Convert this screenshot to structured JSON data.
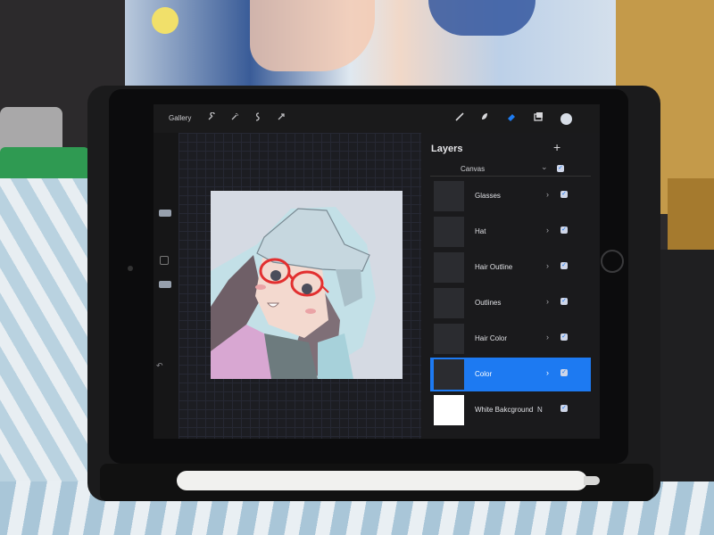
{
  "app": {
    "gallery_label": "Gallery"
  },
  "toolbar": {
    "left_tools": [
      "wrench-icon",
      "magic-wand-icon",
      "selection-icon",
      "transform-arrow-icon"
    ],
    "right_tools": [
      "brush-icon",
      "smudge-icon",
      "eraser-icon",
      "layers-icon",
      "color-icon"
    ],
    "active_color": "#d7dde6",
    "accent_color": "#1e7cf2"
  },
  "layers": {
    "title": "Layers",
    "add_icon": "+",
    "canvas_label": "Canvas",
    "items": [
      {
        "name": "Glasses",
        "visible": true,
        "active": false
      },
      {
        "name": "Hat",
        "visible": true,
        "active": false
      },
      {
        "name": "Hair Outline",
        "visible": true,
        "active": false
      },
      {
        "name": "Outlines",
        "visible": true,
        "active": false
      },
      {
        "name": "Hair Color",
        "visible": true,
        "active": false
      },
      {
        "name": "Color",
        "visible": true,
        "active": true
      },
      {
        "name": "White Bakcground",
        "visible": true,
        "active": false,
        "blend_mode": "N"
      }
    ]
  },
  "glyphs": {
    "chevron": "›",
    "check": "✓",
    "chevron_down": "⌄"
  }
}
